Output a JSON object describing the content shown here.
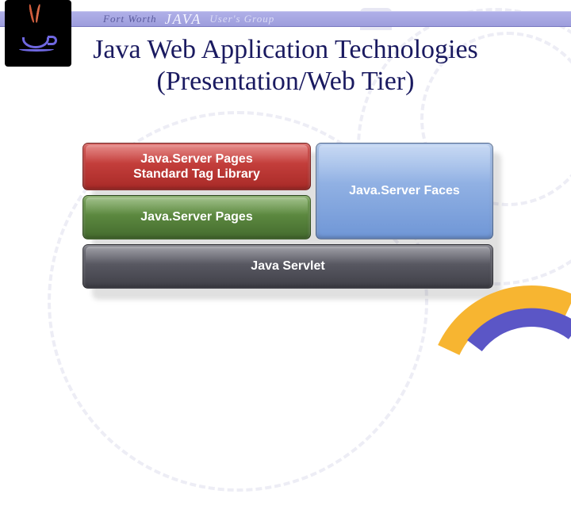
{
  "banner": {
    "fort": "Fort Worth",
    "java": "JAVA",
    "ug": "User's Group"
  },
  "title": {
    "line1": "Java Web Application Technologies",
    "line2": "(Presentation/Web Tier)"
  },
  "diagram": {
    "blocks": {
      "jstl": "Java.Server Pages\nStandard Tag Library",
      "jsf": "Java.Server Faces",
      "jsp": "Java.Server Pages",
      "servlet": "Java Servlet"
    },
    "colors": {
      "jstl": "#c0392b",
      "jsf": "#7ea3dc",
      "jsp": "#5a8a3e",
      "servlet": "#55555e"
    }
  }
}
